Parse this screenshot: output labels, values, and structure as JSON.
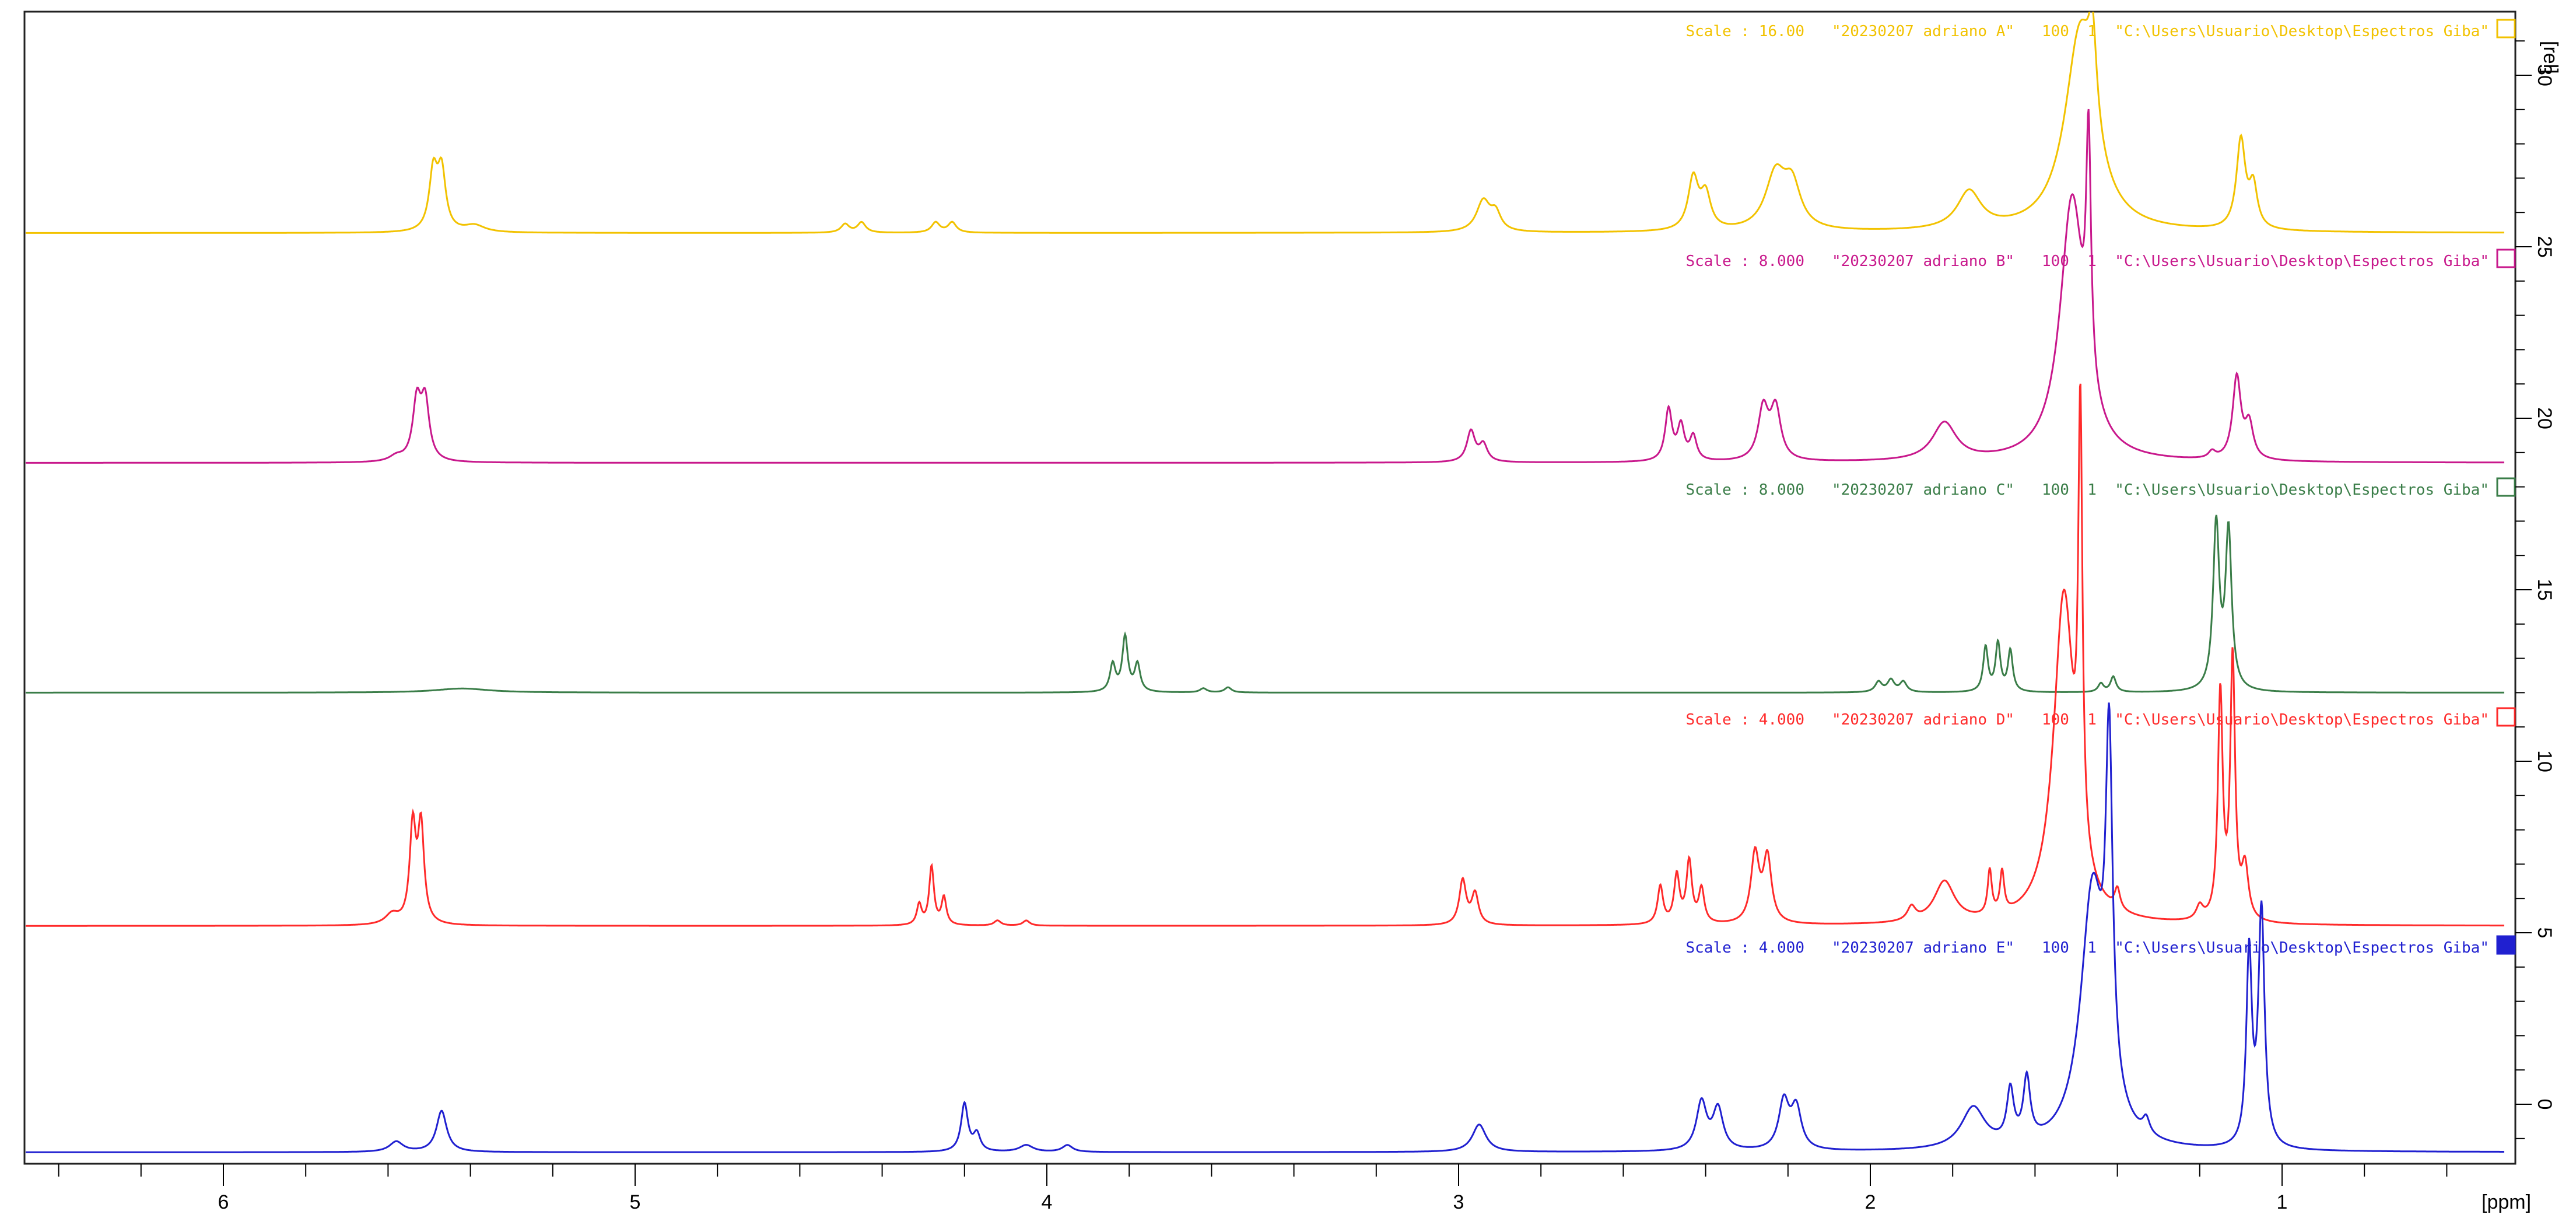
{
  "chart_data": {
    "type": "line",
    "title": "",
    "xlabel": "[ppm]",
    "ylabel": "[rel]",
    "xlim": [
      6.48,
      0.46
    ],
    "ylim": [
      -2.7,
      31
    ],
    "x_ticks": [
      "6",
      "5",
      "4",
      "3",
      "2",
      "1"
    ],
    "x_tick_values": [
      6,
      5,
      4,
      3,
      2,
      1
    ],
    "y_ticks": [
      "0",
      "5",
      "10",
      "15",
      "20",
      "25",
      "30"
    ],
    "y_tick_values": [
      0,
      5,
      10,
      15,
      20,
      25,
      30
    ],
    "grid": false,
    "series": [
      {
        "name": "20230207 adriano A",
        "label": "Scale : 16.00   \"20230207 adriano A\"   100  1  \"C:\\Users\\Usuario\\Desktop\\Espectros Giba\"",
        "color": "#f2c200",
        "baseline": 25.4,
        "legend_filled": false,
        "peaks": [
          [
            5.49,
            1.7,
            0.012
          ],
          [
            5.47,
            1.7,
            0.012
          ],
          [
            5.39,
            0.2,
            0.03
          ],
          [
            4.49,
            0.25,
            0.012
          ],
          [
            4.45,
            0.3,
            0.012
          ],
          [
            4.27,
            0.3,
            0.012
          ],
          [
            4.23,
            0.3,
            0.012
          ],
          [
            2.94,
            0.9,
            0.02
          ],
          [
            2.91,
            0.5,
            0.015
          ],
          [
            2.43,
            1.5,
            0.015
          ],
          [
            2.4,
            1.0,
            0.015
          ],
          [
            2.23,
            1.6,
            0.03
          ],
          [
            2.19,
            1.2,
            0.025
          ],
          [
            1.76,
            1.1,
            0.035
          ],
          [
            1.49,
            5.8,
            0.045
          ],
          [
            1.46,
            2.5,
            0.012
          ],
          [
            1.1,
            2.6,
            0.013
          ],
          [
            1.07,
            1.2,
            0.012
          ]
        ]
      },
      {
        "name": "20230207 adriano B",
        "label": "Scale : 8.000   \"20230207 adriano B\"   100  1  \"C:\\Users\\Usuario\\Desktop\\Espectros Giba\"",
        "color": "#c8188c",
        "baseline": 18.7,
        "legend_filled": false,
        "peaks": [
          [
            5.53,
            1.7,
            0.012
          ],
          [
            5.51,
            1.7,
            0.012
          ],
          [
            5.58,
            0.15,
            0.02
          ],
          [
            2.97,
            0.9,
            0.012
          ],
          [
            2.94,
            0.5,
            0.012
          ],
          [
            2.49,
            1.5,
            0.01
          ],
          [
            2.46,
            1.0,
            0.01
          ],
          [
            2.43,
            0.7,
            0.01
          ],
          [
            2.26,
            1.5,
            0.015
          ],
          [
            2.23,
            1.5,
            0.015
          ],
          [
            1.82,
            1.1,
            0.035
          ],
          [
            1.51,
            7.6,
            0.035
          ],
          [
            1.47,
            7.0,
            0.007
          ],
          [
            1.11,
            2.4,
            0.012
          ],
          [
            1.08,
            1.0,
            0.012
          ],
          [
            1.17,
            0.2,
            0.01
          ]
        ]
      },
      {
        "name": "20230207 adriano C",
        "label": "Scale : 8.000   \"20230207 adriano C\"   100  1  \"C:\\Users\\Usuario\\Desktop\\Espectros Giba\"",
        "color": "#3a7d48",
        "baseline": 12.0,
        "legend_filled": false,
        "peaks": [
          [
            5.42,
            0.12,
            0.08
          ],
          [
            3.84,
            0.8,
            0.008
          ],
          [
            3.81,
            1.6,
            0.008
          ],
          [
            3.78,
            0.8,
            0.008
          ],
          [
            3.62,
            0.12,
            0.01
          ],
          [
            3.56,
            0.15,
            0.01
          ],
          [
            1.98,
            0.3,
            0.01
          ],
          [
            1.95,
            0.35,
            0.01
          ],
          [
            1.92,
            0.3,
            0.01
          ],
          [
            1.72,
            1.3,
            0.007
          ],
          [
            1.69,
            1.4,
            0.007
          ],
          [
            1.66,
            1.2,
            0.007
          ],
          [
            1.41,
            0.45,
            0.008
          ],
          [
            1.44,
            0.25,
            0.008
          ],
          [
            1.16,
            4.8,
            0.009
          ],
          [
            1.13,
            4.6,
            0.009
          ]
        ]
      },
      {
        "name": "20230207 adriano D",
        "label": "Scale : 4.000   \"20230207 adriano D\"   100  1  \"C:\\Users\\Usuario\\Desktop\\Espectros Giba\"",
        "color": "#ff2a2a",
        "baseline": 5.2,
        "legend_filled": false,
        "peaks": [
          [
            5.54,
            2.8,
            0.009
          ],
          [
            5.52,
            2.8,
            0.009
          ],
          [
            5.59,
            0.3,
            0.02
          ],
          [
            4.28,
            1.7,
            0.007
          ],
          [
            4.25,
            0.8,
            0.007
          ],
          [
            4.31,
            0.6,
            0.007
          ],
          [
            4.12,
            0.15,
            0.01
          ],
          [
            4.05,
            0.15,
            0.01
          ],
          [
            2.99,
            1.3,
            0.01
          ],
          [
            2.96,
            0.9,
            0.01
          ],
          [
            2.51,
            1.1,
            0.008
          ],
          [
            2.47,
            1.4,
            0.008
          ],
          [
            2.44,
            1.8,
            0.008
          ],
          [
            2.41,
            1.0,
            0.008
          ],
          [
            2.28,
            2.0,
            0.012
          ],
          [
            2.25,
            1.9,
            0.012
          ],
          [
            1.82,
            1.2,
            0.03
          ],
          [
            1.9,
            0.4,
            0.012
          ],
          [
            1.71,
            1.3,
            0.006
          ],
          [
            1.68,
            1.2,
            0.006
          ],
          [
            1.53,
            9.5,
            0.03
          ],
          [
            1.49,
            12.5,
            0.006
          ],
          [
            1.4,
            0.6,
            0.008
          ],
          [
            1.15,
            6.6,
            0.007
          ],
          [
            1.12,
            7.6,
            0.007
          ],
          [
            1.09,
            1.5,
            0.01
          ],
          [
            1.2,
            0.4,
            0.01
          ]
        ]
      },
      {
        "name": "20230207 adriano E",
        "label": "Scale : 4.000   \"20230207 adriano E\"   100  1  \"C:\\Users\\Usuario\\Desktop\\Espectros Giba\"",
        "color": "#2020d0",
        "baseline": -1.4,
        "legend_filled": true,
        "peaks": [
          [
            5.47,
            1.2,
            0.015
          ],
          [
            5.58,
            0.3,
            0.02
          ],
          [
            4.2,
            1.4,
            0.01
          ],
          [
            4.17,
            0.5,
            0.01
          ],
          [
            4.05,
            0.2,
            0.02
          ],
          [
            3.95,
            0.2,
            0.015
          ],
          [
            2.95,
            0.8,
            0.02
          ],
          [
            2.41,
            1.4,
            0.015
          ],
          [
            2.37,
            1.2,
            0.015
          ],
          [
            2.21,
            1.4,
            0.015
          ],
          [
            2.18,
            1.2,
            0.015
          ],
          [
            1.75,
            1.2,
            0.035
          ],
          [
            1.66,
            1.5,
            0.01
          ],
          [
            1.62,
            1.8,
            0.01
          ],
          [
            1.46,
            7.5,
            0.035
          ],
          [
            1.42,
            9.8,
            0.01
          ],
          [
            1.33,
            0.45,
            0.01
          ],
          [
            1.08,
            5.6,
            0.008
          ],
          [
            1.05,
            6.9,
            0.009
          ]
        ]
      }
    ]
  }
}
